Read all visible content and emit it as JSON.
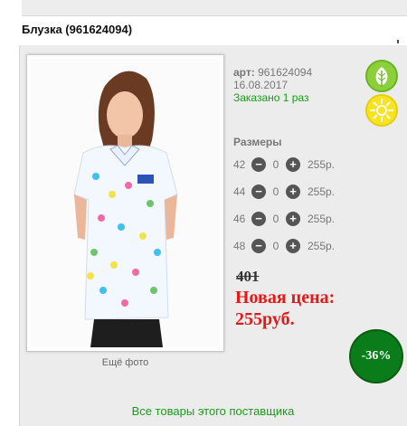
{
  "product": {
    "title": "Блузка (961624094)",
    "article_label": "арт:",
    "article_value": "961624094",
    "date": "16.08.2017",
    "ordered": "Заказано 1 раз",
    "more_photos": "Ещё фото"
  },
  "sizes": {
    "title": "Размеры",
    "rows": [
      {
        "size": "42",
        "minus": "−",
        "qty": "0",
        "plus": "+",
        "price": "255р."
      },
      {
        "size": "44",
        "minus": "−",
        "qty": "0",
        "plus": "+",
        "price": "255р."
      },
      {
        "size": "46",
        "minus": "−",
        "qty": "0",
        "plus": "+",
        "price": "255р."
      },
      {
        "size": "48",
        "minus": "−",
        "qty": "0",
        "plus": "+",
        "price": "255р."
      }
    ]
  },
  "pricing": {
    "old_price": "401",
    "new_price_label": "Новая цена:",
    "new_price_value": "255руб.",
    "discount": "-36%"
  },
  "footer": {
    "supplier_link": "Все товары этого поставщика"
  },
  "icons": {
    "eco": "leaf-icon",
    "season": "sun-icon"
  },
  "colors": {
    "green_text": "#1a9a1a",
    "red_price": "#e11a1a",
    "badge": "#0a7d1a"
  }
}
